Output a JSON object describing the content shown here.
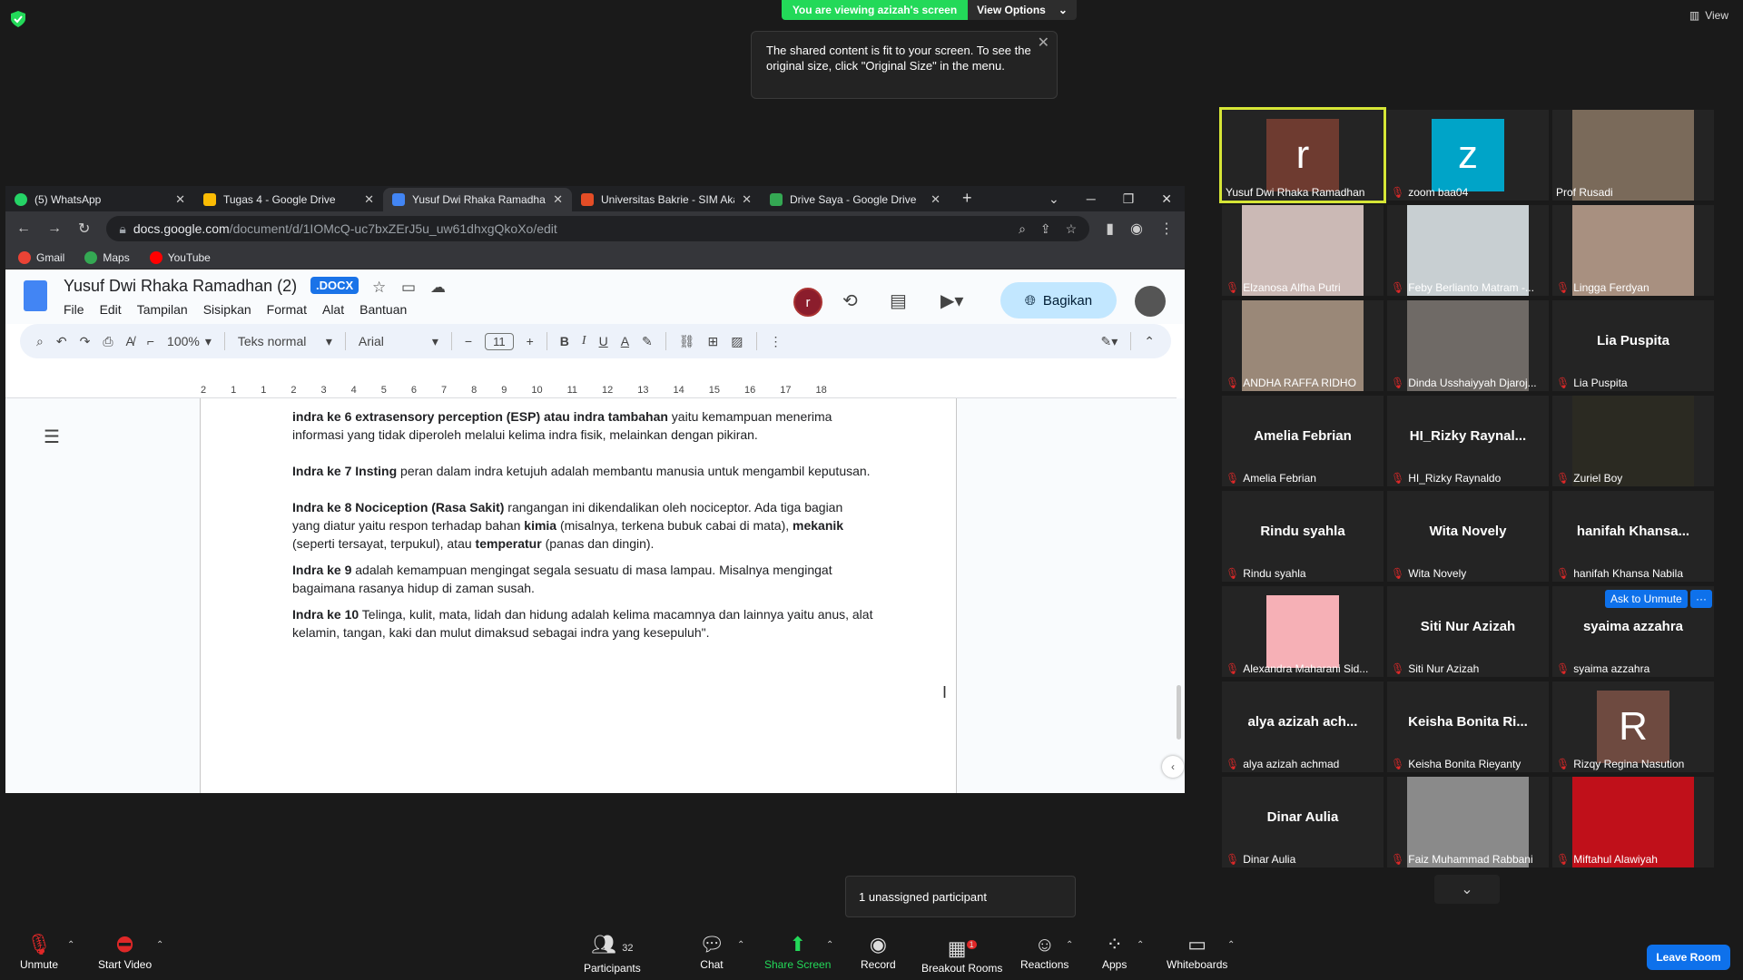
{
  "zoom_top": {
    "viewing_banner": "You are viewing azizah's screen",
    "view_options": "View Options",
    "tooltip": "The shared content is fit to your screen. To see the original size, click \"Original Size\" in the menu.",
    "view_label": "View"
  },
  "browser": {
    "tabs": [
      {
        "label": "(5) WhatsApp",
        "color": "#25d366"
      },
      {
        "label": "Tugas 4 - Google Drive",
        "color": "#fbbc04"
      },
      {
        "label": "Yusuf Dwi Rhaka Ramadhan",
        "color": "#4285f4"
      },
      {
        "label": "Universitas Bakrie - SIM Akademik",
        "color": "#e44d26"
      },
      {
        "label": "Drive Saya - Google Drive",
        "color": "#34a853"
      }
    ],
    "url_domain": "docs.google.com",
    "url_path": "/document/d/1IOMcQ-uc7bxZErJ5u_uw61dhxgQkoXo/edit",
    "bookmarks": [
      {
        "label": "Gmail",
        "color": "#ea4335"
      },
      {
        "label": "Maps",
        "color": "#34a853"
      },
      {
        "label": "YouTube",
        "color": "#ff0000"
      }
    ]
  },
  "docs": {
    "title": "Yusuf Dwi Rhaka Ramadhan (2)",
    "badge": ".DOCX",
    "menu": [
      "File",
      "Edit",
      "Tampilan",
      "Sisipkan",
      "Format",
      "Alat",
      "Bantuan"
    ],
    "share_label": "Bagikan",
    "collaborator_initial": "r",
    "zoom": "100%",
    "style": "Teks normal",
    "font": "Arial",
    "font_size": "11",
    "ruler": [
      "2",
      "1",
      "1",
      "2",
      "3",
      "4",
      "5",
      "6",
      "7",
      "8",
      "9",
      "10",
      "11",
      "12",
      "13",
      "14",
      "15",
      "16",
      "17",
      "18"
    ],
    "paragraphs": [
      {
        "bold": "indra ke 6 extrasensory perception (ESP) atau indra tambahan",
        "text": " yaitu kemampuan menerima informasi yang tidak diperoleh melalui kelima indra fisik, melainkan dengan pikiran."
      },
      {
        "bold": "Indra ke 7 Insting",
        "text": " peran dalam indra ketujuh adalah membantu manusia untuk mengambil keputusan."
      },
      {
        "bold": "Indra ke 8 Nociception (Rasa Sakit)",
        "text": " rangangan ini dikendalikan oleh nociceptor. Ada tiga bagian yang diatur yaitu respon terhadap bahan ",
        "b2": "kimia",
        "t2": " (misalnya, terkena bubuk cabai di mata), ",
        "b3": "mekanik",
        "t3": " (seperti tersayat, terpukul), atau ",
        "b4": "temperatur",
        "t4": " (panas dan dingin)."
      },
      {
        "bold": "Indra ke 9",
        "text": " adalah kemampuan mengingat segala sesuatu di masa lampau. Misalnya mengingat bagaimana rasanya hidup di zaman susah."
      },
      {
        "bold": "Indra ke 10",
        "text": " Telinga, kulit, mata, lidah dan hidung adalah kelima macamnya dan lainnya yaitu anus, alat kelamin, tangan, kaki dan mulut dimaksud sebagai indra yang kesepuluh\"."
      }
    ]
  },
  "gallery": {
    "tiles": [
      {
        "name": "Yusuf Dwi Rhaka Ramadhan",
        "avatar": "r",
        "avatar_color": "#6e3b30",
        "muted": false,
        "speaking": true
      },
      {
        "name": "zoom baa04",
        "avatar": "z",
        "avatar_color": "#00a4c8",
        "muted": true
      },
      {
        "name": "Prof Rusadi",
        "video": "#7a6a5a",
        "muted": false
      },
      {
        "name": "Elzanosa Alfha Putri",
        "video": "#cbb9b5",
        "muted": true
      },
      {
        "name": "Feby Berlianto Matram -...",
        "video": "#c8cfd2",
        "muted": true
      },
      {
        "name": "Lingga Ferdyan",
        "video": "#a89080",
        "muted": true
      },
      {
        "name": "ANDHA RAFFA RIDHO",
        "video": "#9a8878",
        "muted": true
      },
      {
        "name": "Dinda Usshaiyyah Djaroj...",
        "video": "#6f6a66",
        "muted": true
      },
      {
        "name": "Lia Puspita",
        "big": "Lia Puspita",
        "muted": true
      },
      {
        "name": "Amelia Febrian",
        "big": "Amelia Febrian",
        "muted": true
      },
      {
        "name": "HI_Rizky Raynaldo",
        "big": "HI_Rizky  Raynal...",
        "muted": true
      },
      {
        "name": "Zuriel Boy",
        "video": "#2b2a22",
        "muted": true
      },
      {
        "name": "Rindu syahla",
        "big": "Rindu syahla",
        "muted": true
      },
      {
        "name": "Wita Novely",
        "big": "Wita Novely",
        "muted": true
      },
      {
        "name": "hanifah Khansa Nabila",
        "big": "hanifah  Khansa...",
        "muted": true
      },
      {
        "name": "Alexandra Maharani Sid...",
        "avatar": "",
        "avatar_color": "#f6b0b6",
        "muted": true
      },
      {
        "name": "Siti Nur Azizah",
        "big": "Siti Nur Azizah",
        "muted": true
      },
      {
        "name": "syaima azzahra",
        "big": "syaima azzahra",
        "muted": true
      },
      {
        "name": "alya azizah achmad",
        "big": "alya  azizah  ach...",
        "muted": true
      },
      {
        "name": "Keisha Bonita Rieyanty",
        "big": "Keisha  Bonita  Ri...",
        "muted": true
      },
      {
        "name": "Rizqy Regina Nasution",
        "avatar": "R",
        "avatar_color": "#6e4a40",
        "muted": true
      },
      {
        "name": "Dinar Aulia",
        "big": "Dinar Aulia",
        "muted": true
      },
      {
        "name": "Faiz Muhammad Rabbani",
        "video": "#8a8a8a",
        "muted": true
      },
      {
        "name": "Miftahul Alawiyah",
        "video": "#c0101a",
        "muted": true
      }
    ],
    "ask_unmute": "Ask to Unmute",
    "more": "···"
  },
  "unassigned": "1 unassigned participant",
  "bottom": {
    "unmute": "Unmute",
    "start_video": "Start Video",
    "participants": "Participants",
    "participant_count": "32",
    "chat": "Chat",
    "share_screen": "Share Screen",
    "record": "Record",
    "breakout_rooms": "Breakout Rooms",
    "breakout_badge": "1",
    "reactions": "Reactions",
    "apps": "Apps",
    "whiteboards": "Whiteboards",
    "leave": "Leave Room"
  },
  "colors": {
    "zoom_green": "#23d959",
    "zoom_blue": "#0e71eb",
    "docs_blue": "#1a73e8"
  }
}
